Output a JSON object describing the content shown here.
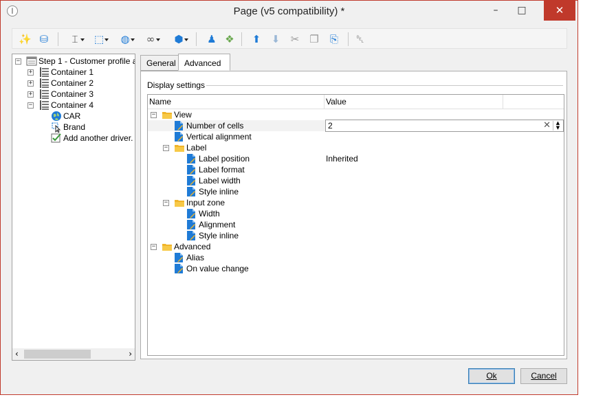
{
  "window": {
    "title": "Page (v5 compatibility) *",
    "app_icon_glyph": "ǀ",
    "minimize_glyph": "–",
    "maximize_glyph": "□",
    "close_glyph": "✕"
  },
  "toolbar": {
    "items": [
      {
        "name": "magic-wand-icon",
        "glyph": "✨",
        "color": "#1f7bd6",
        "dropdown": false
      },
      {
        "name": "database-link-icon",
        "glyph": "⛁",
        "color": "#1f7bd6",
        "dropdown": false
      },
      {
        "name": "text-cursor-icon",
        "glyph": "⌶",
        "color": "#444444",
        "dropdown": true
      },
      {
        "name": "select-control-icon",
        "glyph": "⬚",
        "color": "#1f7bd6",
        "dropdown": true
      },
      {
        "name": "globe-icon",
        "glyph": "◍",
        "color": "#1f7bd6",
        "dropdown": true
      },
      {
        "name": "link-icon",
        "glyph": "∞",
        "color": "#555555",
        "dropdown": true
      },
      {
        "name": "package-icon",
        "glyph": "⬢",
        "color": "#1f7bd6",
        "dropdown": true
      },
      {
        "name": "user-icon",
        "glyph": "♟",
        "color": "#1f7bd6",
        "dropdown": false
      },
      {
        "name": "add-shapes-icon",
        "glyph": "❖",
        "color": "#6aa84f",
        "dropdown": false
      },
      {
        "name": "move-up-icon",
        "glyph": "⬆",
        "color": "#1f7bd6",
        "dropdown": false
      },
      {
        "name": "move-down-icon",
        "glyph": "⬇",
        "color": "#9bb8d6",
        "dropdown": false
      },
      {
        "name": "cut-icon",
        "glyph": "✂",
        "color": "#9a9a9a",
        "dropdown": false
      },
      {
        "name": "copy-icon",
        "glyph": "❐",
        "color": "#9a9a9a",
        "dropdown": false
      },
      {
        "name": "paste-icon",
        "glyph": "⎘",
        "color": "#1f7bd6",
        "dropdown": false
      },
      {
        "name": "delete-icon",
        "glyph": "␡",
        "color": "#555555",
        "dropdown": false
      }
    ]
  },
  "tree": {
    "root_label": "Step 1 - Customer profile a",
    "containers": [
      "Container 1",
      "Container 2",
      "Container 3",
      "Container 4"
    ],
    "children": [
      {
        "label": "CAR",
        "icon": "globe-icon"
      },
      {
        "label": "Brand",
        "icon": "cursor-icon"
      },
      {
        "label": "Add another driver.",
        "icon": "checkbox-icon"
      }
    ],
    "expand_plus": "+",
    "expand_minus": "−",
    "scroll_left": "‹",
    "scroll_right": "›"
  },
  "tabs": [
    {
      "label": "General",
      "active": false
    },
    {
      "label": "Advanced",
      "active": true
    }
  ],
  "display_settings": {
    "group_label": "Display settings",
    "col_name": "Name",
    "col_value": "Value",
    "rows": [
      {
        "label": "View",
        "kind": "folder",
        "level": 0,
        "expand": "minus",
        "value": ""
      },
      {
        "label": "Number of cells",
        "kind": "property",
        "level": 1,
        "value": "2",
        "selected": true
      },
      {
        "label": "Vertical alignment",
        "kind": "property",
        "level": 1,
        "value": ""
      },
      {
        "label": "Label",
        "kind": "folder",
        "level": 1,
        "expand": "minus",
        "value": ""
      },
      {
        "label": "Label position",
        "kind": "property",
        "level": 2,
        "value": "Inherited"
      },
      {
        "label": "Label format",
        "kind": "property",
        "level": 2,
        "value": ""
      },
      {
        "label": "Label width",
        "kind": "property",
        "level": 2,
        "value": ""
      },
      {
        "label": "Style inline",
        "kind": "property",
        "level": 2,
        "value": ""
      },
      {
        "label": "Input zone",
        "kind": "folder",
        "level": 1,
        "expand": "minus",
        "value": ""
      },
      {
        "label": "Width",
        "kind": "property",
        "level": 2,
        "value": ""
      },
      {
        "label": "Alignment",
        "kind": "property",
        "level": 2,
        "value": ""
      },
      {
        "label": "Style inline",
        "kind": "property",
        "level": 2,
        "value": ""
      },
      {
        "label": "Advanced",
        "kind": "folder",
        "level": 0,
        "expand": "minus",
        "value": ""
      },
      {
        "label": "Alias",
        "kind": "property",
        "level": 1,
        "value": ""
      },
      {
        "label": "On value change",
        "kind": "property",
        "level": 1,
        "value": ""
      }
    ],
    "editor": {
      "value": "2",
      "clear_glyph": "✕",
      "up_glyph": "▲",
      "down_glyph": "▼"
    }
  },
  "buttons": {
    "ok_label": "Ok",
    "cancel_label": "Cancel"
  },
  "colors": {
    "folder": "#f0b429",
    "property": "#1f7bd6",
    "accent": "#3c7fb1",
    "close_red": "#c0392b"
  }
}
